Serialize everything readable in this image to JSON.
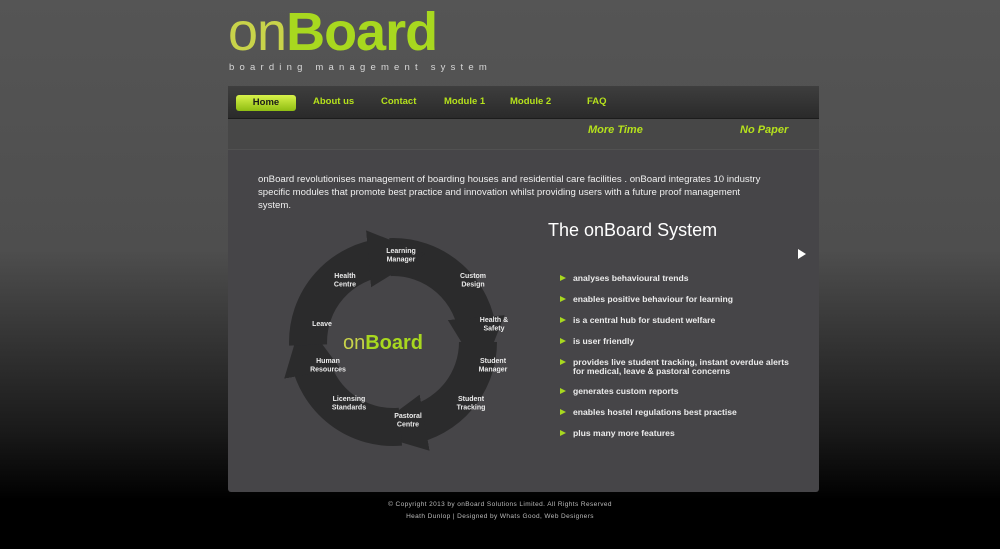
{
  "logo": {
    "word_light": "on",
    "word_bold": "Board",
    "tagline": "boarding management system"
  },
  "nav": {
    "items": [
      "Home",
      "About us",
      "Contact",
      "Module 1",
      "Module 2",
      "FAQ"
    ]
  },
  "taglines": [
    "More Time",
    "No Paper"
  ],
  "intro": "onBoard revolutionises management of boarding houses and residential care facilities . onBoard integrates 10 industry specific modules that promote best practice and innovation whilst providing users with a future proof management system.",
  "system": {
    "title": "The onBoard System",
    "features": [
      "analyses behavioural trends",
      "enables positive behaviour for learning",
      "is a central hub for student welfare",
      "is user friendly",
      "provides live student tracking, instant overdue alerts for medical, leave & pastoral concerns",
      "generates custom reports",
      "enables hostel regulations best practise",
      "plus many more features"
    ]
  },
  "cycle": {
    "center_light": "on",
    "center_bold": "Board",
    "modules": [
      [
        "Learning",
        "Manager"
      ],
      [
        "Custom",
        "Design"
      ],
      [
        "Health &",
        "Safety"
      ],
      [
        "Student",
        "Manager"
      ],
      [
        "Student",
        "Tracking"
      ],
      [
        "Pastoral",
        "Centre"
      ],
      [
        "Licensing",
        "Standards"
      ],
      [
        "Human",
        "Resources"
      ],
      [
        "Leave"
      ],
      [
        "Health",
        "Centre"
      ]
    ]
  },
  "footer": {
    "copyright": "© Copyright 2013 by onBoard Solutions Limited. All Rights Reserved",
    "credits": "Heath Dunlop | Designed by Whats Good, Web Designers"
  },
  "colors": {
    "accent": "#a8d81f",
    "panel": "#464548",
    "nav": "#333333"
  }
}
